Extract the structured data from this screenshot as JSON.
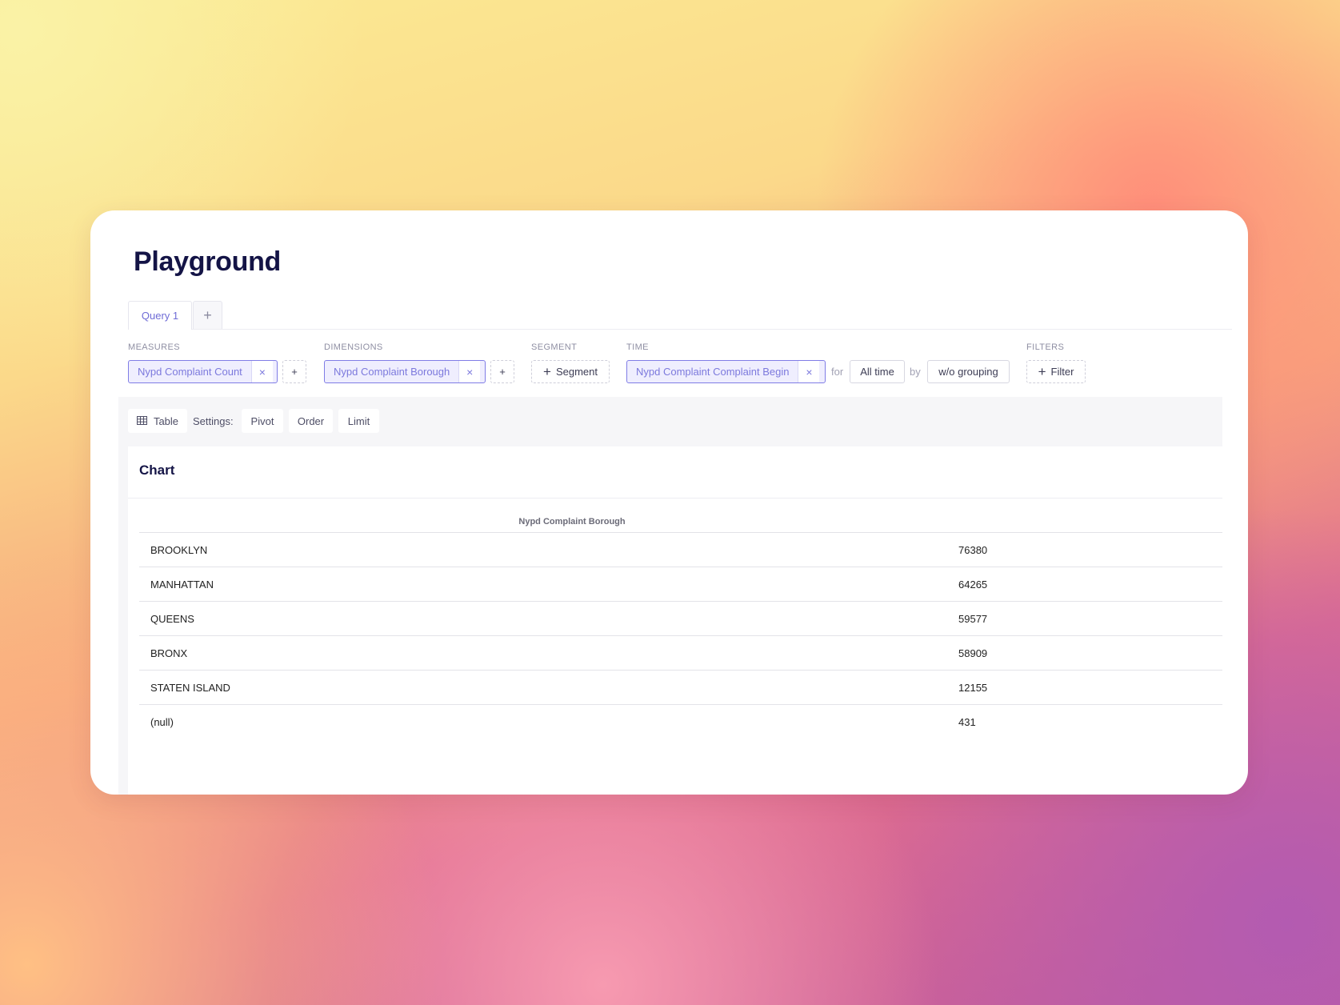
{
  "page_title": "Playground",
  "tabs": [
    {
      "label": "Query 1",
      "active": true
    }
  ],
  "tab_add_label": "+",
  "query": {
    "measures": {
      "label": "MEASURES",
      "items": [
        "Nypd Complaint Count"
      ],
      "remove": "×",
      "add": "+"
    },
    "dimensions": {
      "label": "DIMENSIONS",
      "items": [
        "Nypd Complaint Borough"
      ],
      "remove": "×",
      "add": "+"
    },
    "segment": {
      "label": "SEGMENT",
      "button": "Segment"
    },
    "time": {
      "label": "TIME",
      "member": "Nypd Complaint Complaint Begin",
      "remove": "×",
      "for_word": "for",
      "range": "All time",
      "by_word": "by",
      "granularity": "w/o grouping"
    },
    "filters": {
      "label": "FILTERS",
      "button": "Filter"
    }
  },
  "toolbar": {
    "chart_type": "Table",
    "settings_label": "Settings:",
    "pivot": "Pivot",
    "order": "Order",
    "limit": "Limit"
  },
  "chart": {
    "title": "Chart",
    "column_header": "Nypd Complaint Borough",
    "rows": [
      {
        "borough": "BROOKLYN",
        "count": "76380"
      },
      {
        "borough": "MANHATTAN",
        "count": "64265"
      },
      {
        "borough": "QUEENS",
        "count": "59577"
      },
      {
        "borough": "BRONX",
        "count": "58909"
      },
      {
        "borough": "STATEN ISLAND",
        "count": "12155"
      },
      {
        "borough": "(null)",
        "count": "431"
      }
    ]
  },
  "colors": {
    "accent": "#7c79dd",
    "pill_background": "#efeefe",
    "title": "#141446"
  }
}
